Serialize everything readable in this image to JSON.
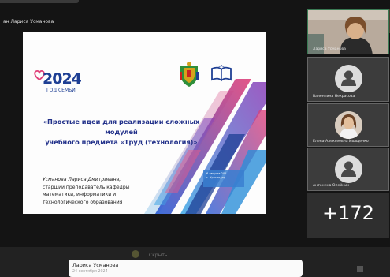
{
  "presenter_label": "ан Лариса Усманова",
  "slide": {
    "logo_number": "2024",
    "logo_subtitle": "ГОД СЕМЬИ",
    "title_line1": "«Простые идеи для реализации сложных модулей",
    "title_line2": "учебного предмета «Труд (технология)»",
    "author_name": "Усманова Лариса Дмитриевна,",
    "author_line2": "старший преподаватель кафедры",
    "author_line3": "математики, информатики и",
    "author_line4": "технологического образования",
    "date_line1": "6 августа 202",
    "date_line2": "г. Краснодар",
    "colors": {
      "title": "#22318a",
      "logo": "#1e3f94"
    }
  },
  "participants": [
    {
      "name": "Лариса Усманова",
      "avatar": "video"
    },
    {
      "name": "Валентина Некрасова",
      "avatar": "person-icon"
    },
    {
      "name": "Елена-Алексеевна Иващенко",
      "avatar": "photo"
    },
    {
      "name": "Антонина Олейник",
      "avatar": "person-icon"
    }
  ],
  "more_participants": "+172",
  "bottom": {
    "ghost_text": "Скрыть",
    "toast_name": "Лариса Усманова",
    "toast_date": "24 сентября 2024"
  }
}
